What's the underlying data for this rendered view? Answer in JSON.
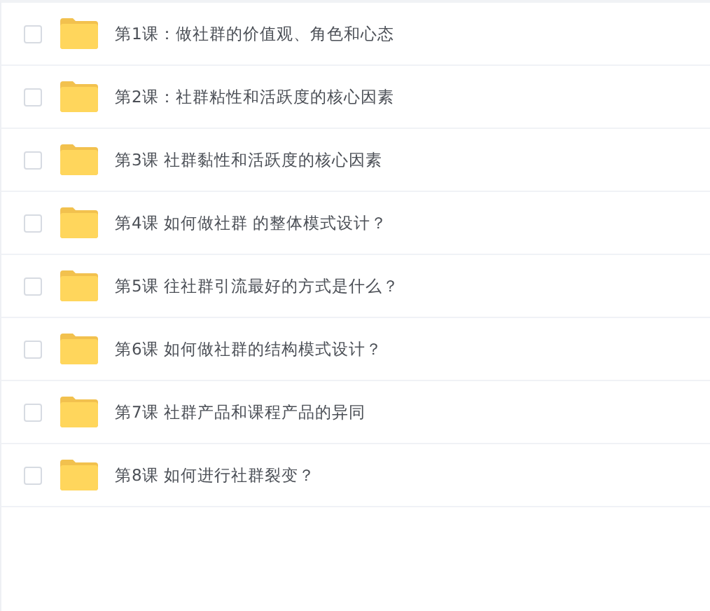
{
  "files": [
    {
      "name": "第1课：做社群的价值观、角色和心态",
      "checked": false
    },
    {
      "name": "第2课：社群粘性和活跃度的核心因素",
      "checked": false
    },
    {
      "name": "第3课 社群黏性和活跃度的核心因素",
      "checked": false
    },
    {
      "name": "第4课 如何做社群 的整体模式设计？",
      "checked": false
    },
    {
      "name": "第5课 往社群引流最好的方式是什么？",
      "checked": false
    },
    {
      "name": "第6课 如何做社群的结构模式设计？",
      "checked": false
    },
    {
      "name": "第7课 社群产品和课程产品的异同",
      "checked": false
    },
    {
      "name": "第8课 如何进行社群裂变？",
      "checked": false
    }
  ]
}
